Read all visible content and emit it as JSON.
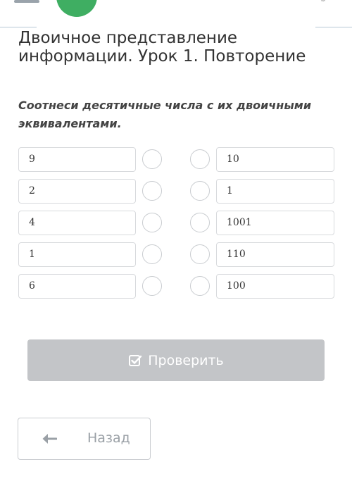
{
  "header": {
    "icons": {
      "menu": "hamburger-menu-icon",
      "avatar": "green-avatar-circle",
      "corner": "settings-icon"
    },
    "accent_color": "#3fae62"
  },
  "lesson": {
    "title": "Двоичное представление информации. Урок 1. Повторение"
  },
  "task": {
    "instruction": "Соотнеси десятичные числа с их двоичными эквивалентами."
  },
  "matching": {
    "left": [
      "9",
      "2",
      "4",
      "1",
      "6"
    ],
    "right": [
      "10",
      "1",
      "1001",
      "110",
      "100"
    ]
  },
  "buttons": {
    "check_label": "Проверить",
    "check_icon": "check-square-icon",
    "check_color": "#c3c5c8",
    "back_label": "Назад",
    "back_icon": "arrow-left-icon"
  }
}
